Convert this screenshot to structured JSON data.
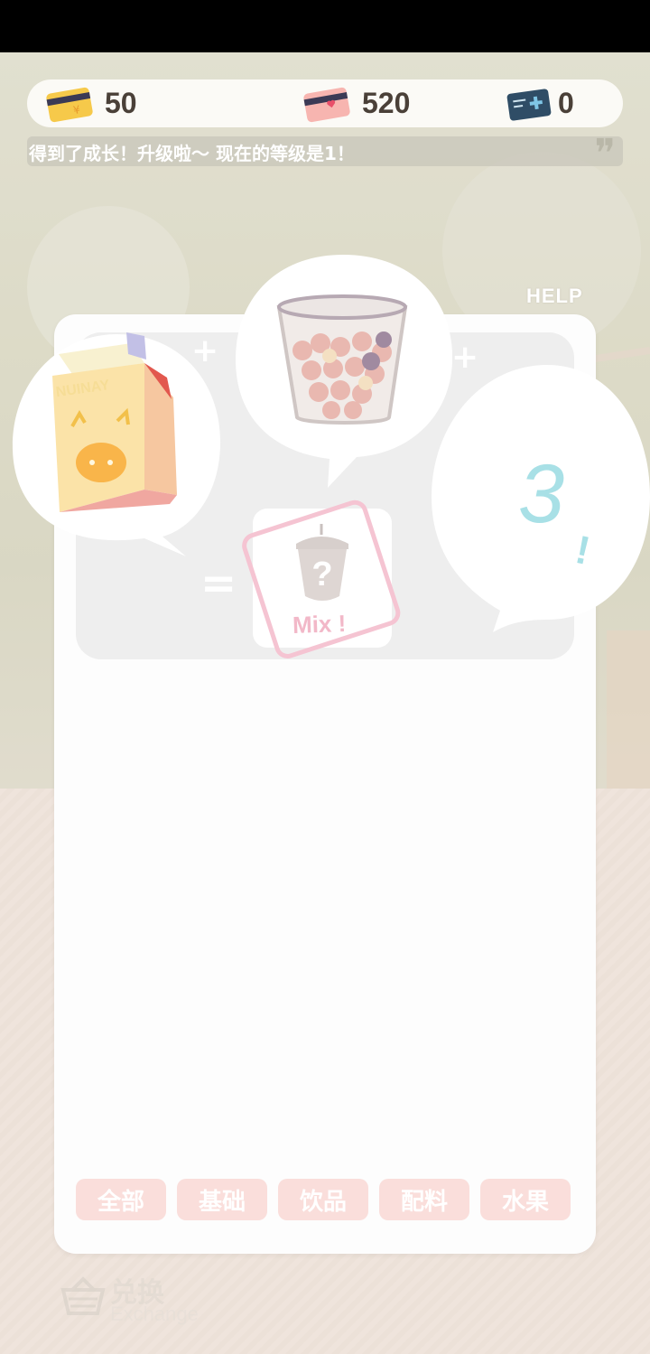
{
  "currencies": [
    {
      "icon": "gold-card-icon",
      "value": "50"
    },
    {
      "icon": "pink-heart-card-icon",
      "value": "520"
    },
    {
      "icon": "blue-ticket-icon",
      "value": "0"
    }
  ],
  "ticker": {
    "text": "得到了成长！升级啦〜 现在的等级是1！",
    "quote": "❞"
  },
  "help_label": "HELP",
  "mix": {
    "ingredient_1": {
      "icon": "milk-carton-icon",
      "carton_text": "NUINAY"
    },
    "ingredient_2": {
      "icon": "boba-pearls-cup-icon"
    },
    "result_label": "Mix !",
    "countdown": "3",
    "countdown_mark": "!"
  },
  "tabs": [
    "全部",
    "基础",
    "饮品",
    "配料",
    "水果"
  ],
  "exchange": {
    "label": "兑换",
    "sub_label": "Exchange"
  },
  "colors": {
    "tab_bg": "#fadedb",
    "accent_pink": "#f2b8c8",
    "countdown": "#a8e0e6"
  }
}
